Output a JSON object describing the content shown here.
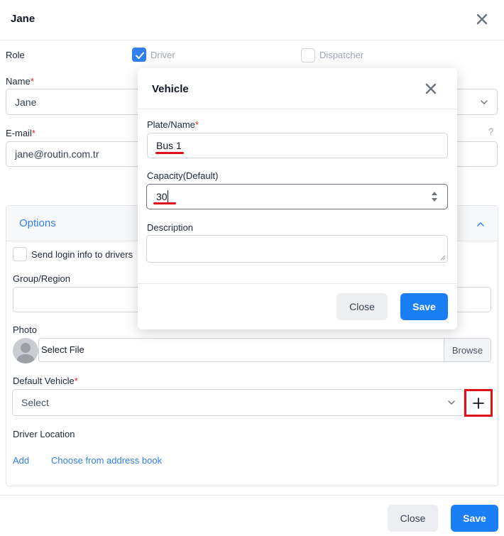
{
  "modal": {
    "title": "Jane",
    "role_label": "Role",
    "role_options": [
      {
        "label": "Driver",
        "checked": true
      },
      {
        "label": "Dispatcher",
        "checked": false
      }
    ],
    "name_label": "Name",
    "name_value": "Jane",
    "email_label": "E-mail",
    "email_value": "jane@routin.com.tr",
    "help_glyph": "?",
    "required_mark": "*"
  },
  "options": {
    "title": "Options",
    "send_login_label": "Send login info to drivers",
    "send_login_checked": false,
    "group_label": "Group/Region",
    "group_value": "",
    "photo_label": "Photo",
    "photo_file_text": "Select File",
    "photo_browse_label": "Browse",
    "vehicle_label": "Default Vehicle",
    "vehicle_value": "Select",
    "location_label": "Driver Location",
    "location_add": "Add",
    "location_address_book": "Choose from address book"
  },
  "footer": {
    "close_label": "Close",
    "save_label": "Save"
  },
  "vehicle_dialog": {
    "title": "Vehicle",
    "plate_label": "Plate/Name",
    "plate_value": "Bus 1",
    "capacity_label": "Capacity(Default)",
    "capacity_value": "30",
    "description_label": "Description",
    "description_value": "",
    "close_label": "Close",
    "save_label": "Save"
  },
  "colors": {
    "accent": "#1a7ff5",
    "link": "#2f7ff0",
    "required": "#dc2626",
    "annotation": "#e0101a"
  },
  "icons": [
    "close-icon",
    "check-icon",
    "chevron-down-icon",
    "chevron-up-icon",
    "help-icon",
    "avatar-icon",
    "plus-icon",
    "spinner-arrows-icon",
    "resize-handle-icon"
  ]
}
